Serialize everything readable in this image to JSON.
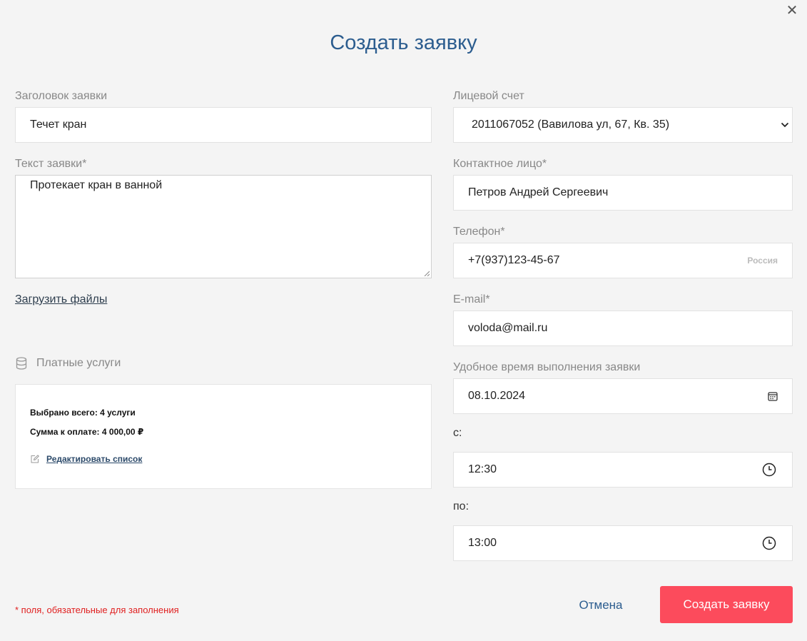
{
  "dialog": {
    "title": "Создать заявку",
    "close_glyph": "✕"
  },
  "form": {
    "request_title": {
      "label": "Заголовок заявки",
      "value": "Течет кран"
    },
    "request_text": {
      "label": "Текст заявки*",
      "value": "Протекает кран в ванной"
    },
    "upload_link": "Загрузить файлы",
    "account": {
      "label": "Лицевой счет",
      "value": "2011067052 (Вавилова ул, 67, Кв. 35)"
    },
    "contact": {
      "label": "Контактное лицо*",
      "value": "Петров Андрей Сергеевич"
    },
    "phone": {
      "label": "Телефон*",
      "value": "+7(937)123-45-67",
      "country": "Россия"
    },
    "email": {
      "label": "E-mail*",
      "value": "voloda@mail.ru"
    },
    "preferred_time": {
      "label": "Удобное время выполнения заявки",
      "date": "08.10.2024"
    },
    "time_from": {
      "label": "с:",
      "value": "12:30"
    },
    "time_to": {
      "label": "по:",
      "value": "13:00"
    }
  },
  "services": {
    "header": "Платные услуги",
    "selected_total": "Выбрано всего: 4 услуги",
    "amount_due": "Сумма к оплате: 4 000,00 ₽",
    "edit_link": "Редактировать список"
  },
  "footer": {
    "required_note": "* поля, обязательные для заполнения",
    "cancel_label": "Отмена",
    "submit_label": "Создать заявку"
  },
  "colors": {
    "title": "#2c5d8f",
    "submit": "#fc4b5c",
    "required": "#e02020"
  },
  "icons": {
    "close": "close-icon",
    "select_arrow": "chevron-down-icon",
    "calendar": "calendar-icon",
    "clock": "clock-icon",
    "database": "database-icon",
    "edit": "edit-icon"
  }
}
